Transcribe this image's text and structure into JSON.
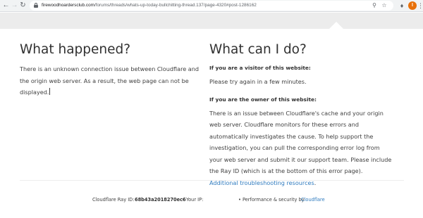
{
  "browser": {
    "back_icon": "arrow-left-icon",
    "forward_icon": "arrow-right-icon",
    "reload_icon": "reload-icon",
    "url_host": "firewoodhoardersclub.com",
    "url_path": "/forums/threads/whats-up-today-bullchitting-thread.137/page-4320#post-1286162",
    "avatar_letter": "I",
    "avatar_color": "#e8710a"
  },
  "left": {
    "title": "What happened?",
    "body": "There is an unknown connection issue between Cloudflare and the origin web server. As a result, the web page can not be displayed."
  },
  "right": {
    "title": "What can I do?",
    "visitor_heading": "If you are a visitor of this website:",
    "visitor_body": "Please try again in a few minutes.",
    "owner_heading": "If you are the owner of this website:",
    "owner_body": "There is an issue between Cloudflare's cache and your origin web server. Cloudflare monitors for these errors and automatically investigates the cause. To help support the investigation, you can pull the corresponding error log from your web server and submit it our support team. Please include the Ray ID (which is at the bottom of this error page).",
    "owner_link": "Additional troubleshooting resources",
    "owner_link_suffix": "."
  },
  "footer": {
    "ray_id_label": "Cloudflare Ray ID:",
    "ray_id_value": "68b43a2018270ec6",
    "your_ip": "• Your IP:",
    "performance": "• Performance & security by",
    "cloudflare_link": "Cloudflare"
  },
  "colors": {
    "link": "#2f7bbf",
    "band": "#ececec"
  }
}
